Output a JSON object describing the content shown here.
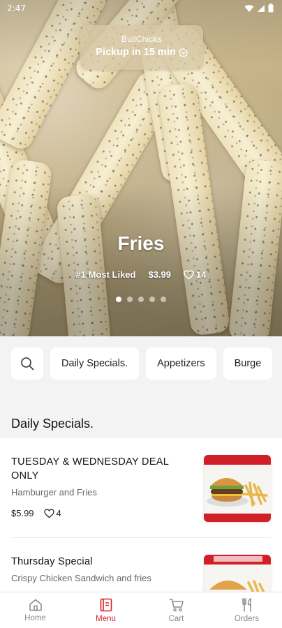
{
  "status": {
    "time": "2:47"
  },
  "restaurant": {
    "name": "BullChicks",
    "pickup": "Pickup in 15 min"
  },
  "hero": {
    "title": "Fries",
    "badge": "#1 Most Liked",
    "price": "$3.99",
    "likes": "14",
    "slides": 5,
    "active_slide": 0
  },
  "categories": {
    "items": [
      "Daily Specials.",
      "Appetizers",
      "Burge"
    ]
  },
  "section": {
    "title": "Daily Specials."
  },
  "menu_items": [
    {
      "name": "TUESDAY & WEDNESDAY DEAL ONLY",
      "description": "Hamburger and Fries",
      "price": "$5.99",
      "likes": "4"
    },
    {
      "name": "Thursday Special",
      "description": "Crispy Chicken Sandwich and fries"
    }
  ],
  "nav": {
    "home": "Home",
    "menu": "Menu",
    "cart": "Cart",
    "orders": "Orders",
    "active": "menu"
  },
  "colors": {
    "accent": "#d61f26",
    "muted": "#888888",
    "background": "#f3f3f3"
  }
}
